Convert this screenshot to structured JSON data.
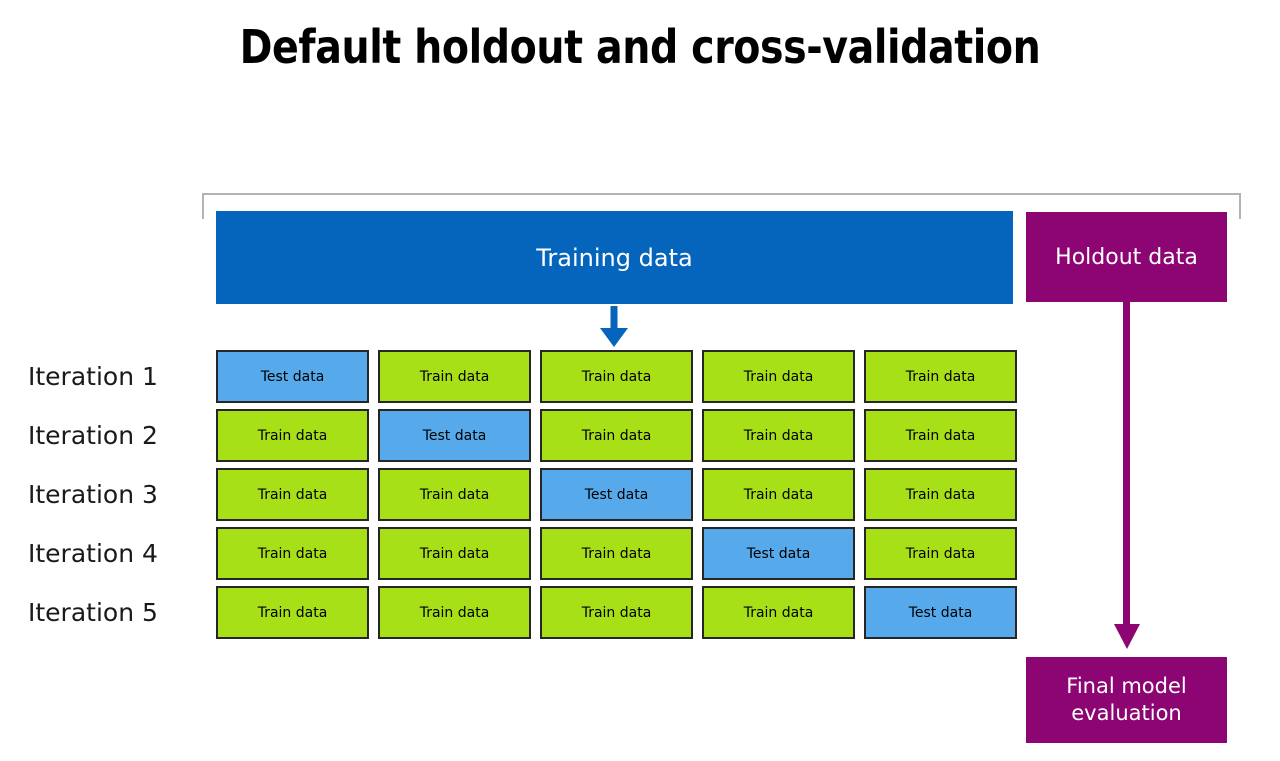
{
  "slide": {
    "title": "Default holdout and cross-validation"
  },
  "colors": {
    "training_blue": "#0565BC",
    "holdout_purple": "#8C0573",
    "train_green": "#A8E018",
    "test_blue": "#56AAEB",
    "frame_gray": "#b3b3b3",
    "cell_border": "#262626",
    "text_white": "#ffffff",
    "text_black": "#000000"
  },
  "dataset": {
    "frame_name": "full-dataset-bracket",
    "training": {
      "label": "Training data"
    },
    "holdout": {
      "label": "Holdout data"
    }
  },
  "arrows": {
    "training_split": {
      "name": "split-down-arrow",
      "direction": "down",
      "color": "#0565BC"
    },
    "holdout_to_eval": {
      "name": "holdout-to-evaluation-arrow",
      "direction": "down",
      "color": "#8C0573"
    }
  },
  "cross_validation": {
    "fold_labels": {
      "train": "Train data",
      "test": "Test data"
    },
    "iterations": [
      {
        "label": "Iteration 1",
        "folds": [
          "test",
          "train",
          "train",
          "train",
          "train"
        ]
      },
      {
        "label": "Iteration 2",
        "folds": [
          "train",
          "test",
          "train",
          "train",
          "train"
        ]
      },
      {
        "label": "Iteration 3",
        "folds": [
          "train",
          "train",
          "test",
          "train",
          "train"
        ]
      },
      {
        "label": "Iteration 4",
        "folds": [
          "train",
          "train",
          "train",
          "test",
          "train"
        ]
      },
      {
        "label": "Iteration 5",
        "folds": [
          "train",
          "train",
          "train",
          "train",
          "test"
        ]
      }
    ]
  },
  "final_evaluation": {
    "line1": "Final model",
    "line2": "evaluation"
  }
}
